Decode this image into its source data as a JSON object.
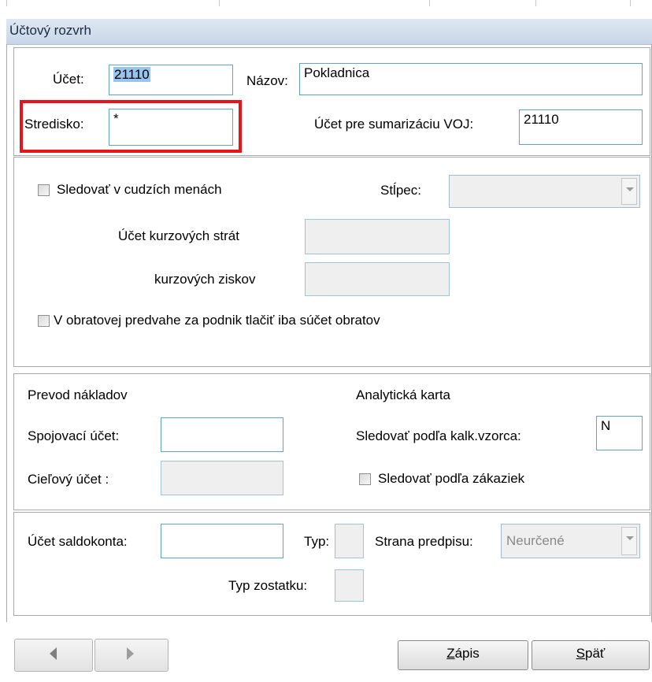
{
  "window": {
    "title": "Účtový rozvrh"
  },
  "section1": {
    "ucet_label": "Účet:",
    "ucet_value": "21110",
    "nazov_label": "Názov:",
    "nazov_value": "Pokladnica",
    "stredisko_label": "Stredisko:",
    "stredisko_value": "*",
    "sumarizacia_label": "Účet pre sumarizáciu VOJ:",
    "sumarizacia_value": "21110"
  },
  "section2": {
    "cudzie_meny_label": "Sledovať v cudzích menách",
    "stlpec_label": "Stĺpec:",
    "stlpec_value": "",
    "kurzove_straty_label": "Účet kurzových strát",
    "kurzove_straty_value": "",
    "kurzove_zisky_label": "kurzových ziskov",
    "kurzove_zisky_value": "",
    "obratova_label": "V obratovej predvahe za podnik tlačiť iba súčet obratov"
  },
  "section3": {
    "prevod_heading": "Prevod nákladov",
    "spojovaci_label": "Spojovací účet:",
    "spojovaci_value": "",
    "cielovy_label": "Cieľový účet  :",
    "cielovy_value": "",
    "analyticka_heading": "Analytická karta",
    "kalk_label": "Sledovať podľa kalk.vzorca:",
    "kalk_value": "N",
    "zakazky_label": "Sledovať podľa zákaziek"
  },
  "section4": {
    "saldokonto_label": "Účet saldokonta:",
    "saldokonto_value": "",
    "typ_label": "Typ:",
    "typ_value": "",
    "strana_label": "Strana predpisu:",
    "strana_value": "Neurčené",
    "typ_zostatku_label": "Typ zostatku:",
    "typ_zostatku_value": ""
  },
  "buttons": {
    "zapis_first": "Z",
    "zapis_rest": "ápis",
    "spat_first": "S",
    "spat_rest": "päť"
  },
  "colors": {
    "highlight": "#e8141c",
    "field_border": "#5fa6b8",
    "selection": "#99c4f0"
  }
}
